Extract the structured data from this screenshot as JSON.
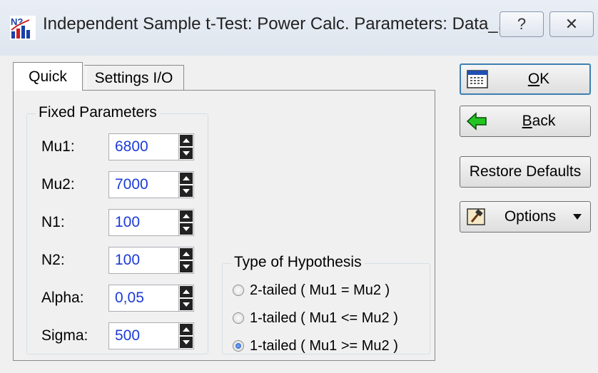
{
  "window": {
    "title": "Independent Sample t-Test: Power Calc. Parameters: Data_...",
    "help_label": "?",
    "close_label": "✕"
  },
  "tabs": [
    {
      "label": "Quick",
      "selected": true
    },
    {
      "label": "Settings I/O",
      "selected": false
    }
  ],
  "fixed_parameters": {
    "legend": "Fixed Parameters",
    "fields": [
      {
        "label": "Mu1:",
        "value": "6800"
      },
      {
        "label": "Mu2:",
        "value": "7000"
      },
      {
        "label": "N1:",
        "value": "100"
      },
      {
        "label": "N2:",
        "value": "100"
      },
      {
        "label": "Alpha:",
        "value": "0,05"
      },
      {
        "label": "Sigma:",
        "value": "500"
      }
    ]
  },
  "hypothesis": {
    "legend": "Type of Hypothesis",
    "options": [
      {
        "label": "2-tailed ( Mu1 = Mu2 )",
        "checked": false
      },
      {
        "label": "1-tailed ( Mu1 <= Mu2 )",
        "checked": false
      },
      {
        "label": "1-tailed ( Mu1 >= Mu2 )",
        "checked": true
      }
    ]
  },
  "buttons": {
    "ok": "OK",
    "back": "Back",
    "restore_defaults": "Restore Defaults",
    "options": "Options"
  },
  "colors": {
    "value_text": "#1c3bd8",
    "back_arrow": "#22c522",
    "default_button_border": "#3c7fb1"
  }
}
